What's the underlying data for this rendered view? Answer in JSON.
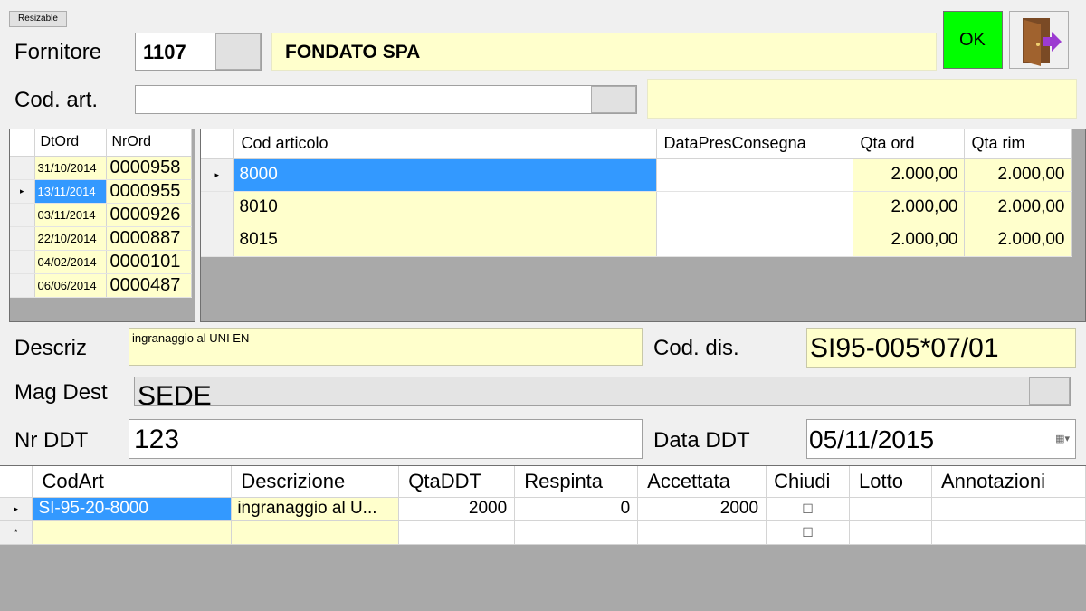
{
  "toolbar": {
    "resizable_label": "Resizable",
    "ok_label": "OK",
    "exit_icon": "exit-door-icon"
  },
  "supplier": {
    "label": "Fornitore",
    "code": "1107",
    "name": "FONDATO SPA"
  },
  "article": {
    "label": "Cod. art.",
    "value": "",
    "description": ""
  },
  "orders": {
    "columns": [
      "DtOrd",
      "NrOrd"
    ],
    "rows": [
      {
        "date": "31/10/2014",
        "number": "0000958"
      },
      {
        "date": "13/11/2014",
        "number": "0000955"
      },
      {
        "date": "03/11/2014",
        "number": "0000926"
      },
      {
        "date": "22/10/2014",
        "number": "0000887"
      },
      {
        "date": "04/02/2014",
        "number": "0000101"
      },
      {
        "date": "06/06/2014",
        "number": "0000487"
      }
    ],
    "selected_index": 1,
    "row_marker": "▸"
  },
  "items": {
    "columns": [
      "Cod articolo",
      "DataPresConsegna",
      "Qta ord",
      "Qta rim"
    ],
    "rows": [
      {
        "code": "8000",
        "date": "",
        "qty_ord": "2.000,00",
        "qty_rim": "2.000,00"
      },
      {
        "code": "8010",
        "date": "",
        "qty_ord": "2.000,00",
        "qty_rim": "2.000,00"
      },
      {
        "code": "8015",
        "date": "",
        "qty_ord": "2.000,00",
        "qty_rim": "2.000,00"
      }
    ],
    "selected_index": 0,
    "row_marker": "▸"
  },
  "details": {
    "descr_label": "Descriz",
    "descr_value": "ingranaggio al UNI EN",
    "cod_dis_label": "Cod. dis.",
    "cod_dis_value": "SI95-005*07/01",
    "mag_label": "Mag Dest",
    "mag_value": "SEDE",
    "nr_ddt_label": "Nr DDT",
    "nr_ddt_value": "123",
    "data_ddt_label": "Data DDT",
    "data_ddt_value": "05/11/2015"
  },
  "ddt_grid": {
    "columns": [
      "CodArt",
      "Descrizione",
      "QtaDDT",
      "Respinta",
      "Accettata",
      "Chiudi",
      "Lotto",
      "Annotazioni"
    ],
    "rows": [
      {
        "marker": "▸",
        "codart": "SI-95-20-8000",
        "descr": "ingranaggio al U...",
        "qta": "2000",
        "respinta": "0",
        "accettata": "2000",
        "chiudi": "☐",
        "lotto": "",
        "note": ""
      },
      {
        "marker": "*",
        "codart": "",
        "descr": "",
        "qta": "",
        "respinta": "",
        "accettata": "",
        "chiudi": "☐",
        "lotto": "",
        "note": ""
      }
    ]
  },
  "colors": {
    "ok_green": "#00ff00",
    "selection_blue": "#3399ff",
    "input_yellow": "#ffffcc"
  }
}
